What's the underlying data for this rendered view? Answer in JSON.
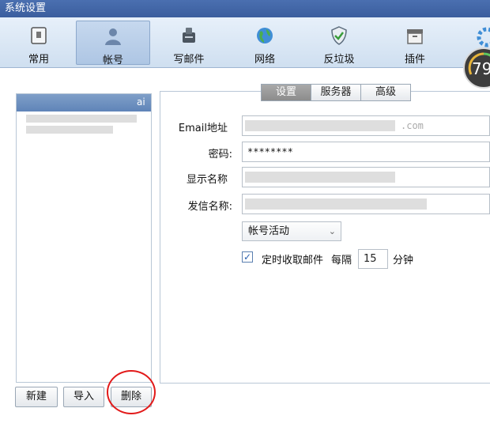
{
  "window": {
    "title": "系统设置"
  },
  "toolbar": {
    "items": [
      {
        "label": "常用",
        "icon": "clipboard-icon"
      },
      {
        "label": "帐号",
        "icon": "user-icon"
      },
      {
        "label": "写邮件",
        "icon": "write-mail-icon"
      },
      {
        "label": "网络",
        "icon": "globe-icon"
      },
      {
        "label": "反垃圾",
        "icon": "shield-icon"
      },
      {
        "label": "插件",
        "icon": "plugin-box-icon"
      }
    ],
    "active_index": 1
  },
  "gauge": {
    "value": "79"
  },
  "accounts": {
    "selected_text": "ai"
  },
  "buttons": {
    "new": "新建",
    "import": "导入",
    "delete": "删除"
  },
  "tabs": {
    "settings": "设置",
    "server": "服务器",
    "advanced": "高级"
  },
  "form": {
    "email_label": "Email地址",
    "email_value": ".com",
    "password_label": "密码:",
    "password_value": "********",
    "display_name_label": "显示名称",
    "sender_name_label": "发信名称:",
    "status_select": "帐号活动",
    "timed_check_label": "定时收取邮件",
    "every_label": "每隔",
    "interval_value": "15",
    "minute_label": "分钟"
  },
  "colors": {
    "accent": "#3b5e9e",
    "highlight_circle": "#e21a1a"
  }
}
